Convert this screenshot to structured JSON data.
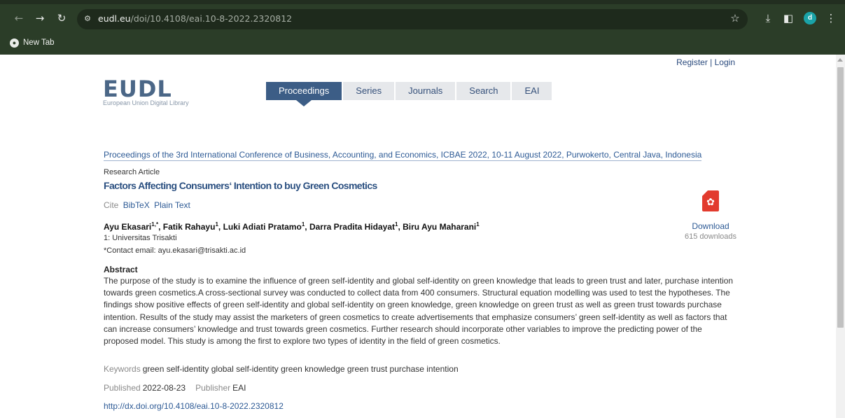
{
  "browser": {
    "url_host": "eudl.eu",
    "url_path": "/doi/10.4108/eai.10-8-2022.2320812",
    "profile_initial": "d",
    "bookmarks": [
      {
        "label": "New Tab"
      }
    ]
  },
  "header": {
    "auth_register": "Register",
    "auth_sep": " | ",
    "auth_login": "Login",
    "logo_text": "EUDL",
    "logo_sub": "European Union Digital Library",
    "menu": [
      {
        "label": "Proceedings",
        "active": true
      },
      {
        "label": "Series",
        "active": false
      },
      {
        "label": "Journals",
        "active": false
      },
      {
        "label": "Search",
        "active": false
      },
      {
        "label": "EAI",
        "active": false
      }
    ]
  },
  "article": {
    "proceedings": "Proceedings of the 3rd International Conference of Business, Accounting, and Economics, ICBAE 2022, 10-11 August 2022, Purwokerto, Central Java, Indonesia",
    "type": "Research Article",
    "title": "Factors Affecting Consumers‘ Intention to buy Green Cosmetics",
    "cite_label": "Cite",
    "cite_links": [
      "BibTeX",
      "Plain Text"
    ],
    "authors": [
      {
        "name": "Ayu Ekasari",
        "sup": "1,*"
      },
      {
        "name": "Fatik Rahayu",
        "sup": "1"
      },
      {
        "name": "Luki Adiati Pratamo",
        "sup": "1"
      },
      {
        "name": "Darra Pradita Hidayat",
        "sup": "1"
      },
      {
        "name": "Biru Ayu Maharani",
        "sup": "1"
      }
    ],
    "affiliation": "1: Universitas Trisakti",
    "contact": "*Contact email: ayu.ekasari@trisakti.ac.id",
    "download_label": "Download",
    "download_count": "615 downloads",
    "abstract_heading": "Abstract",
    "abstract": "The purpose of the study is to examine the influence of green self-identity and global self-identity on green knowledge that leads to green trust and later, purchase intention towards green cosmetics.A cross-sectional survey was conducted to collect data from 400 consumers. Structural equation modelling was used to test the hypotheses. The findings show positive effects of green self-identity and global self-identity on green knowledge, green knowledge on green trust as well as green trust towards purchase intention. Results of the study may assist the marketers of green cosmetics to create advertisements that emphasize consumers’ green self-identity as well as factors that can increase consumers’ knowledge and trust towards green cosmetics. Further research should incorporate other variables to improve the predicting power of the proposed model. This study is among the first to explore two types of identity in the field of green cosmetics.",
    "keywords_label": "Keywords",
    "keywords": "green self-identity global self-identity green knowledge green trust purchase intention",
    "published_label": "Published",
    "published": "2022-08-23",
    "publisher_label": "Publisher",
    "publisher": "EAI",
    "doi": "http://dx.doi.org/10.4108/eai.10-8-2022.2320812"
  },
  "colors": {
    "chrome": "#2b3d28",
    "accent": "#3c5d86",
    "link": "#2d5a95"
  }
}
